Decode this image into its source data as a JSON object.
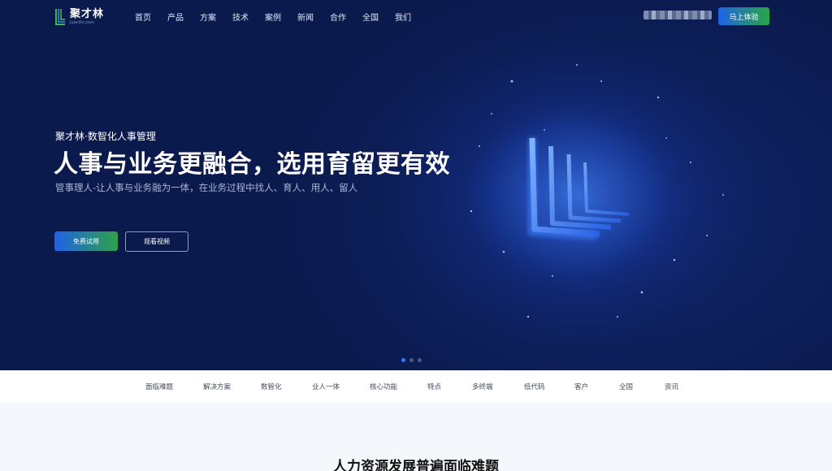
{
  "header": {
    "logo_name": "聚才林",
    "logo_sub": "Juacilin.com",
    "nav": [
      "首页",
      "产品",
      "方案",
      "技术",
      "案例",
      "新闻",
      "合作",
      "全国",
      "我们"
    ],
    "cta_label": "马上体验"
  },
  "hero": {
    "eyebrow": "聚才林·数智化人事管理",
    "title": "人事与业务更融合，选用育留更有效",
    "description": "管事理人-让人事与业务融为一体，在业务过程中找人、育人、用人、留人",
    "trial_button": "免费试用",
    "video_button": "观看视频",
    "slides_total": 3,
    "active_slide": 1
  },
  "subnav": {
    "items": [
      "面临难题",
      "解决方案",
      "数智化",
      "业人一体",
      "核心功能",
      "特点",
      "多终端",
      "低代码",
      "客户",
      "全国",
      "资讯"
    ]
  },
  "section": {
    "title": "人力资源发展普遍面临难题"
  },
  "colors": {
    "hero_bg": "#0b1a4d",
    "cta_start": "#1f62e6",
    "cta_end": "#28a745",
    "active_dot": "#2d7bff"
  },
  "icons": {
    "logo": "logo-l-mark-icon",
    "hero_art": "glowing-l-layers-icon"
  }
}
